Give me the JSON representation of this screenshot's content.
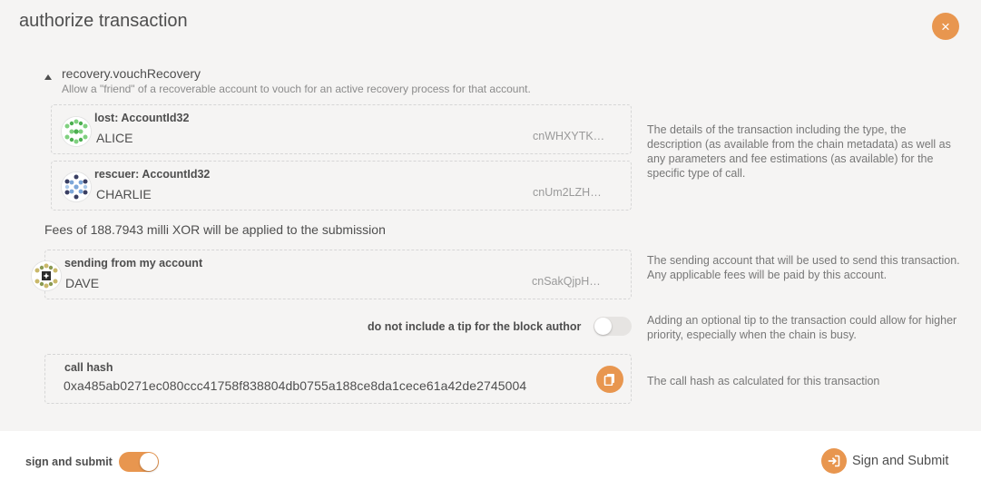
{
  "modal": {
    "title": "authorize transaction",
    "close_icon": "×"
  },
  "call": {
    "name": "recovery.vouchRecovery",
    "description": "Allow a \"friend\" of a recoverable account to vouch for an active recovery process for that account.",
    "params": [
      {
        "label": "lost: AccountId32",
        "value": "ALICE",
        "address": "cnWHXYTK…"
      },
      {
        "label": "rescuer: AccountId32",
        "value": "CHARLIE",
        "address": "cnUm2LZH…"
      }
    ],
    "help": "The details of the transaction including the type, the description (as available from the chain metadata) as well as any parameters and fee estimations (as available) for the specific type of call."
  },
  "fees": {
    "text": "Fees of 188.7943 milli XOR will be applied to the submission"
  },
  "sender": {
    "label": "sending from my account",
    "value": "DAVE",
    "address": "cnSakQjpH…",
    "help": "The sending account that will be used to send this transaction. Any applicable fees will be paid by this account."
  },
  "tip": {
    "label": "do not include a tip for the block author",
    "enabled": false,
    "help": "Adding an optional tip to the transaction could allow for higher priority, especially when the chain is busy."
  },
  "call_hash": {
    "label": "call hash",
    "value": "0xa485ab0271ec080ccc41758f838804db0755a188ce8da1cece61a42de2745004",
    "help": "The call hash as calculated for this transaction"
  },
  "footer": {
    "sign_toggle_label": "sign and submit",
    "sign_toggle_enabled": true,
    "submit_button_label": "Sign and Submit"
  },
  "colors": {
    "accent": "#e8964f",
    "background": "#f5f4f3",
    "footer_bg": "#ffffff"
  },
  "icons": {
    "close": "close-icon",
    "expand": "caret-up-icon",
    "copy": "copy-icon",
    "sign": "sign-in-icon",
    "identicon": "identicon"
  }
}
